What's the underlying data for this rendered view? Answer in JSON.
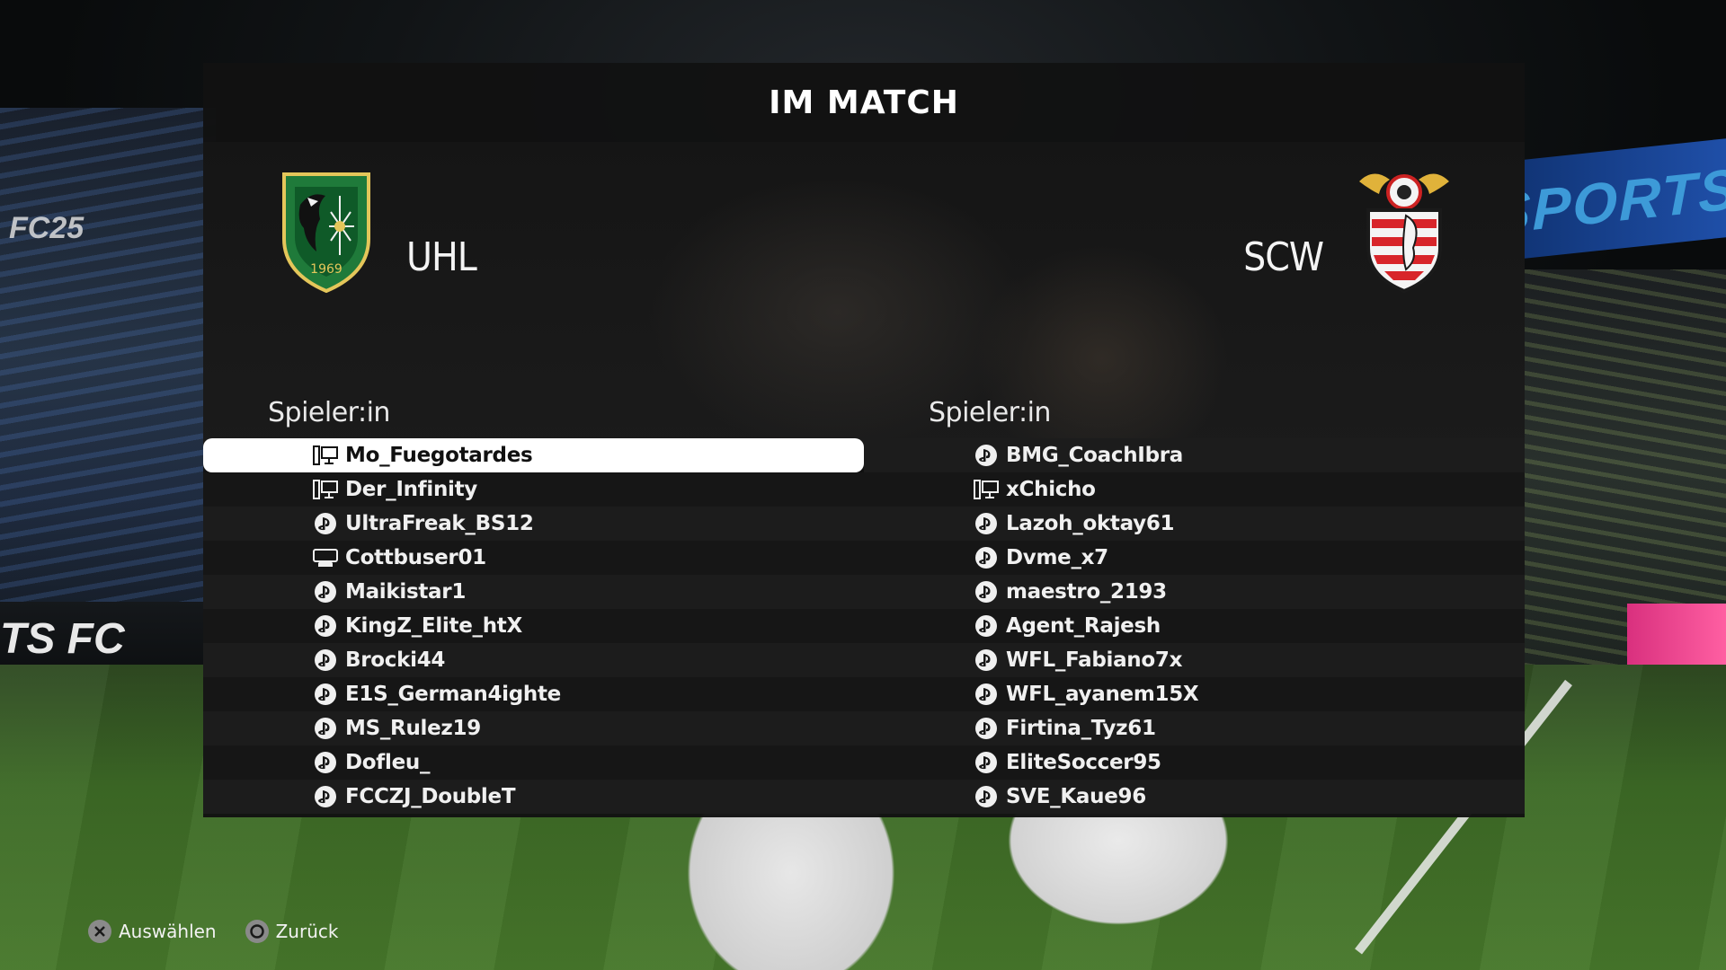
{
  "screen": {
    "title": "IM MATCH"
  },
  "background": {
    "banner_text": "SPORTS",
    "board_text": "TS FC",
    "side_logo": "FC25"
  },
  "home_team": {
    "name": "UHL",
    "crest_icon": "green-eagle-crest-icon",
    "crest_year": "1969",
    "column_header": "Spieler:in",
    "players": [
      {
        "name": "Mo_Fuegotardes",
        "platform": "pc",
        "selected": true
      },
      {
        "name": "Der_Infinity",
        "platform": "pc"
      },
      {
        "name": "UltraFreak_BS12",
        "platform": "playstation"
      },
      {
        "name": "Cottbuser01",
        "platform": "xbox"
      },
      {
        "name": "Maikistar1",
        "platform": "playstation"
      },
      {
        "name": "KingZ_Elite_htX",
        "platform": "playstation"
      },
      {
        "name": "Brocki44",
        "platform": "playstation"
      },
      {
        "name": "E1S_German4ighte",
        "platform": "playstation"
      },
      {
        "name": "MS_Rulez19",
        "platform": "playstation"
      },
      {
        "name": "Dofleu_",
        "platform": "playstation"
      },
      {
        "name": "FCCZJ_DoubleT",
        "platform": "playstation"
      }
    ]
  },
  "away_team": {
    "name": "SCW",
    "crest_icon": "winged-red-shield-crest-icon",
    "column_header": "Spieler:in",
    "players": [
      {
        "name": "BMG_CoachIbra",
        "platform": "playstation"
      },
      {
        "name": "xChicho",
        "platform": "pc"
      },
      {
        "name": "Lazoh_oktay61",
        "platform": "playstation"
      },
      {
        "name": "Dvme_x7",
        "platform": "playstation"
      },
      {
        "name": "maestro_2193",
        "platform": "playstation"
      },
      {
        "name": "Agent_Rajesh",
        "platform": "playstation"
      },
      {
        "name": "WFL_Fabiano7x",
        "platform": "playstation"
      },
      {
        "name": "WFL_ayanem15X",
        "platform": "playstation"
      },
      {
        "name": "Firtina_Tyz61",
        "platform": "playstation"
      },
      {
        "name": "EliteSoccer95",
        "platform": "playstation"
      },
      {
        "name": "SVE_Kaue96",
        "platform": "playstation"
      }
    ]
  },
  "footer": {
    "select": {
      "icon": "cross-button-icon",
      "label": "Auswählen"
    },
    "back": {
      "icon": "circle-button-icon",
      "label": "Zurück"
    }
  },
  "colors": {
    "panel": "#121212",
    "selected_row": "#ffffff",
    "home_crest": "#1f7a3a",
    "away_crest": "#d8252a"
  }
}
